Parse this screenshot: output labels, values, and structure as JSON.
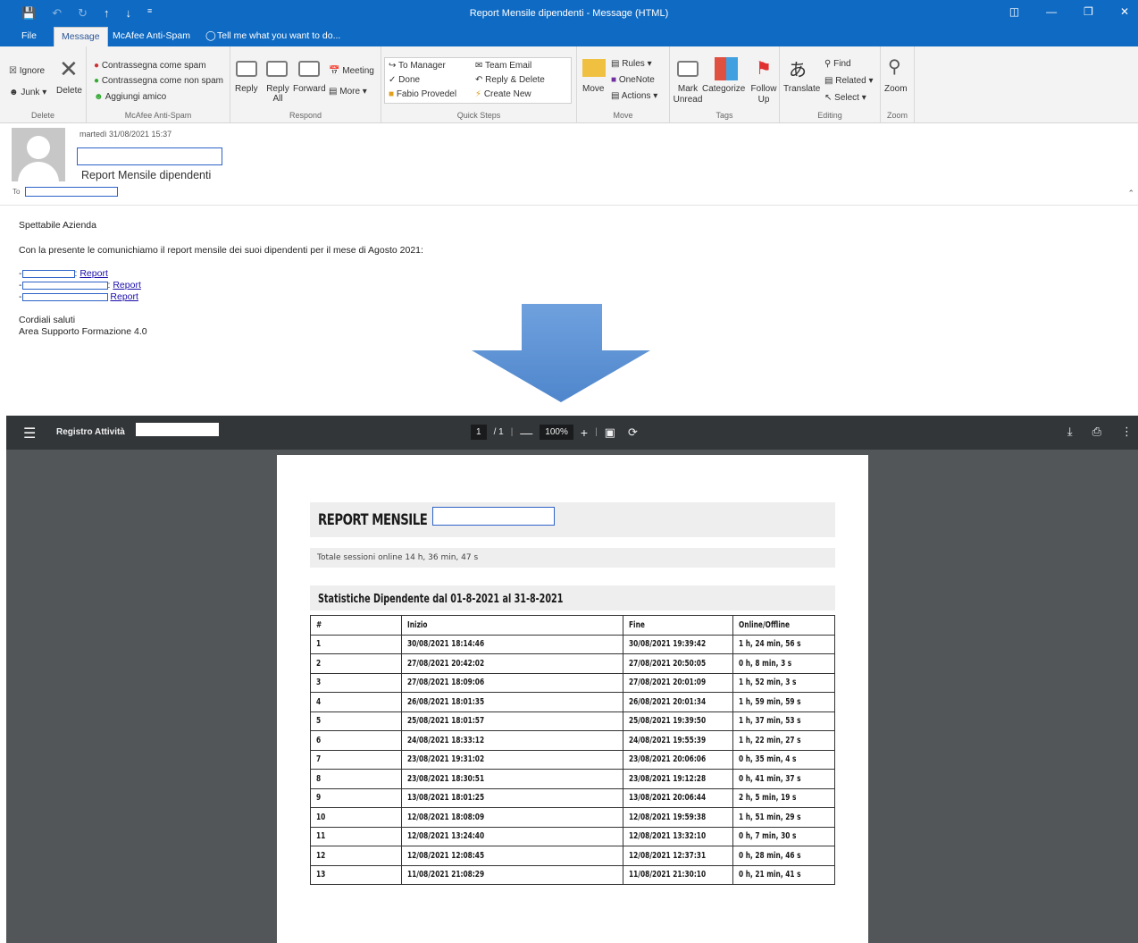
{
  "outlook": {
    "window_title": "Report Mensile dipendenti - Message (HTML)",
    "tabs": [
      {
        "label": "File"
      },
      {
        "label": "Message"
      },
      {
        "label": "McAfee Anti-Spam"
      },
      {
        "label": "Tell me what you want to do..."
      }
    ],
    "ribbon": {
      "delete_group": {
        "label": "Delete",
        "ignore": "Ignore",
        "junk": "Junk",
        "delete": "Delete"
      },
      "mcafee_group": {
        "label": "McAfee Anti-Spam",
        "mark_spam": "Contrassegna come spam",
        "mark_not_spam": "Contrassegna come non spam",
        "add_friend": "Aggiungi amico"
      },
      "respond_group": {
        "label": "Respond",
        "reply": "Reply",
        "reply_all": "Reply All",
        "forward": "Forward",
        "meeting": "Meeting",
        "more": "More"
      },
      "quicksteps_group": {
        "label": "Quick Steps",
        "to_manager": "To Manager",
        "done": "Done",
        "fabio": "Fabio Provedel",
        "team_email": "Team Email",
        "reply_delete": "Reply & Delete",
        "create_new": "Create New"
      },
      "move_group": {
        "label": "Move",
        "move": "Move",
        "rules": "Rules",
        "onenote": "OneNote",
        "actions": "Actions"
      },
      "tags_group": {
        "label": "Tags",
        "mark_unread": "Mark Unread",
        "categorize": "Categorize",
        "follow_up": "Follow Up"
      },
      "editing_group": {
        "label": "Editing",
        "translate": "Translate",
        "find": "Find",
        "related": "Related",
        "select": "Select"
      },
      "zoom_group": {
        "label": "Zoom",
        "zoom": "Zoom"
      }
    },
    "message": {
      "date": "martedì 31/08/2021 15:37",
      "subject": "Report Mensile dipendenti",
      "to_label": "To"
    },
    "body": {
      "greeting": "Spettabile Azienda",
      "intro": "Con la presente le comunichiamo il report mensile dei suoi dipendenti per il mese di Agosto 2021:",
      "links": [
        {
          "prefix": "-",
          "sep": ": ",
          "link_text": "Report"
        },
        {
          "prefix": "-",
          "sep": ": ",
          "link_text": "Report"
        },
        {
          "prefix": "-",
          "sep": " ",
          "link_text": "Report"
        }
      ],
      "closing": "Cordiali saluti",
      "signature": "Area Supporto Formazione 4.0"
    }
  },
  "pdf_viewer": {
    "title": "Registro Attività",
    "page_current": "1",
    "page_total": "/ 1",
    "zoom": "100%",
    "report": {
      "title": "REPORT MENSILE",
      "total_sessions": "Totale sessioni online 14 h, 36 min, 47 s",
      "stats_title": "Statistiche Dipendente dal 01-8-2021 al 31-8-2021",
      "columns": [
        "#",
        "Inizio",
        "Fine",
        "Online/Offline"
      ],
      "rows": [
        [
          "1",
          "30/08/2021 18:14:46",
          "30/08/2021 19:39:42",
          "1 h, 24 min, 56 s"
        ],
        [
          "2",
          "27/08/2021 20:42:02",
          "27/08/2021 20:50:05",
          "0 h, 8 min, 3 s"
        ],
        [
          "3",
          "27/08/2021 18:09:06",
          "27/08/2021 20:01:09",
          "1 h, 52 min, 3 s"
        ],
        [
          "4",
          "26/08/2021 18:01:35",
          "26/08/2021 20:01:34",
          "1 h, 59 min, 59 s"
        ],
        [
          "5",
          "25/08/2021 18:01:57",
          "25/08/2021 19:39:50",
          "1 h, 37 min, 53 s"
        ],
        [
          "6",
          "24/08/2021 18:33:12",
          "24/08/2021 19:55:39",
          "1 h, 22 min, 27 s"
        ],
        [
          "7",
          "23/08/2021 19:31:02",
          "23/08/2021 20:06:06",
          "0 h, 35 min, 4 s"
        ],
        [
          "8",
          "23/08/2021 18:30:51",
          "23/08/2021 19:12:28",
          "0 h, 41 min, 37 s"
        ],
        [
          "9",
          "13/08/2021 18:01:25",
          "13/08/2021 20:06:44",
          "2 h, 5 min, 19 s"
        ],
        [
          "10",
          "12/08/2021 18:08:09",
          "12/08/2021 19:59:38",
          "1 h, 51 min, 29 s"
        ],
        [
          "11",
          "12/08/2021 13:24:40",
          "12/08/2021 13:32:10",
          "0 h, 7 min, 30 s"
        ],
        [
          "12",
          "12/08/2021 12:08:45",
          "12/08/2021 12:37:31",
          "0 h, 28 min, 46 s"
        ],
        [
          "13",
          "11/08/2021 21:08:29",
          "11/08/2021 21:30:10",
          "0 h, 21 min, 41 s"
        ]
      ]
    }
  }
}
